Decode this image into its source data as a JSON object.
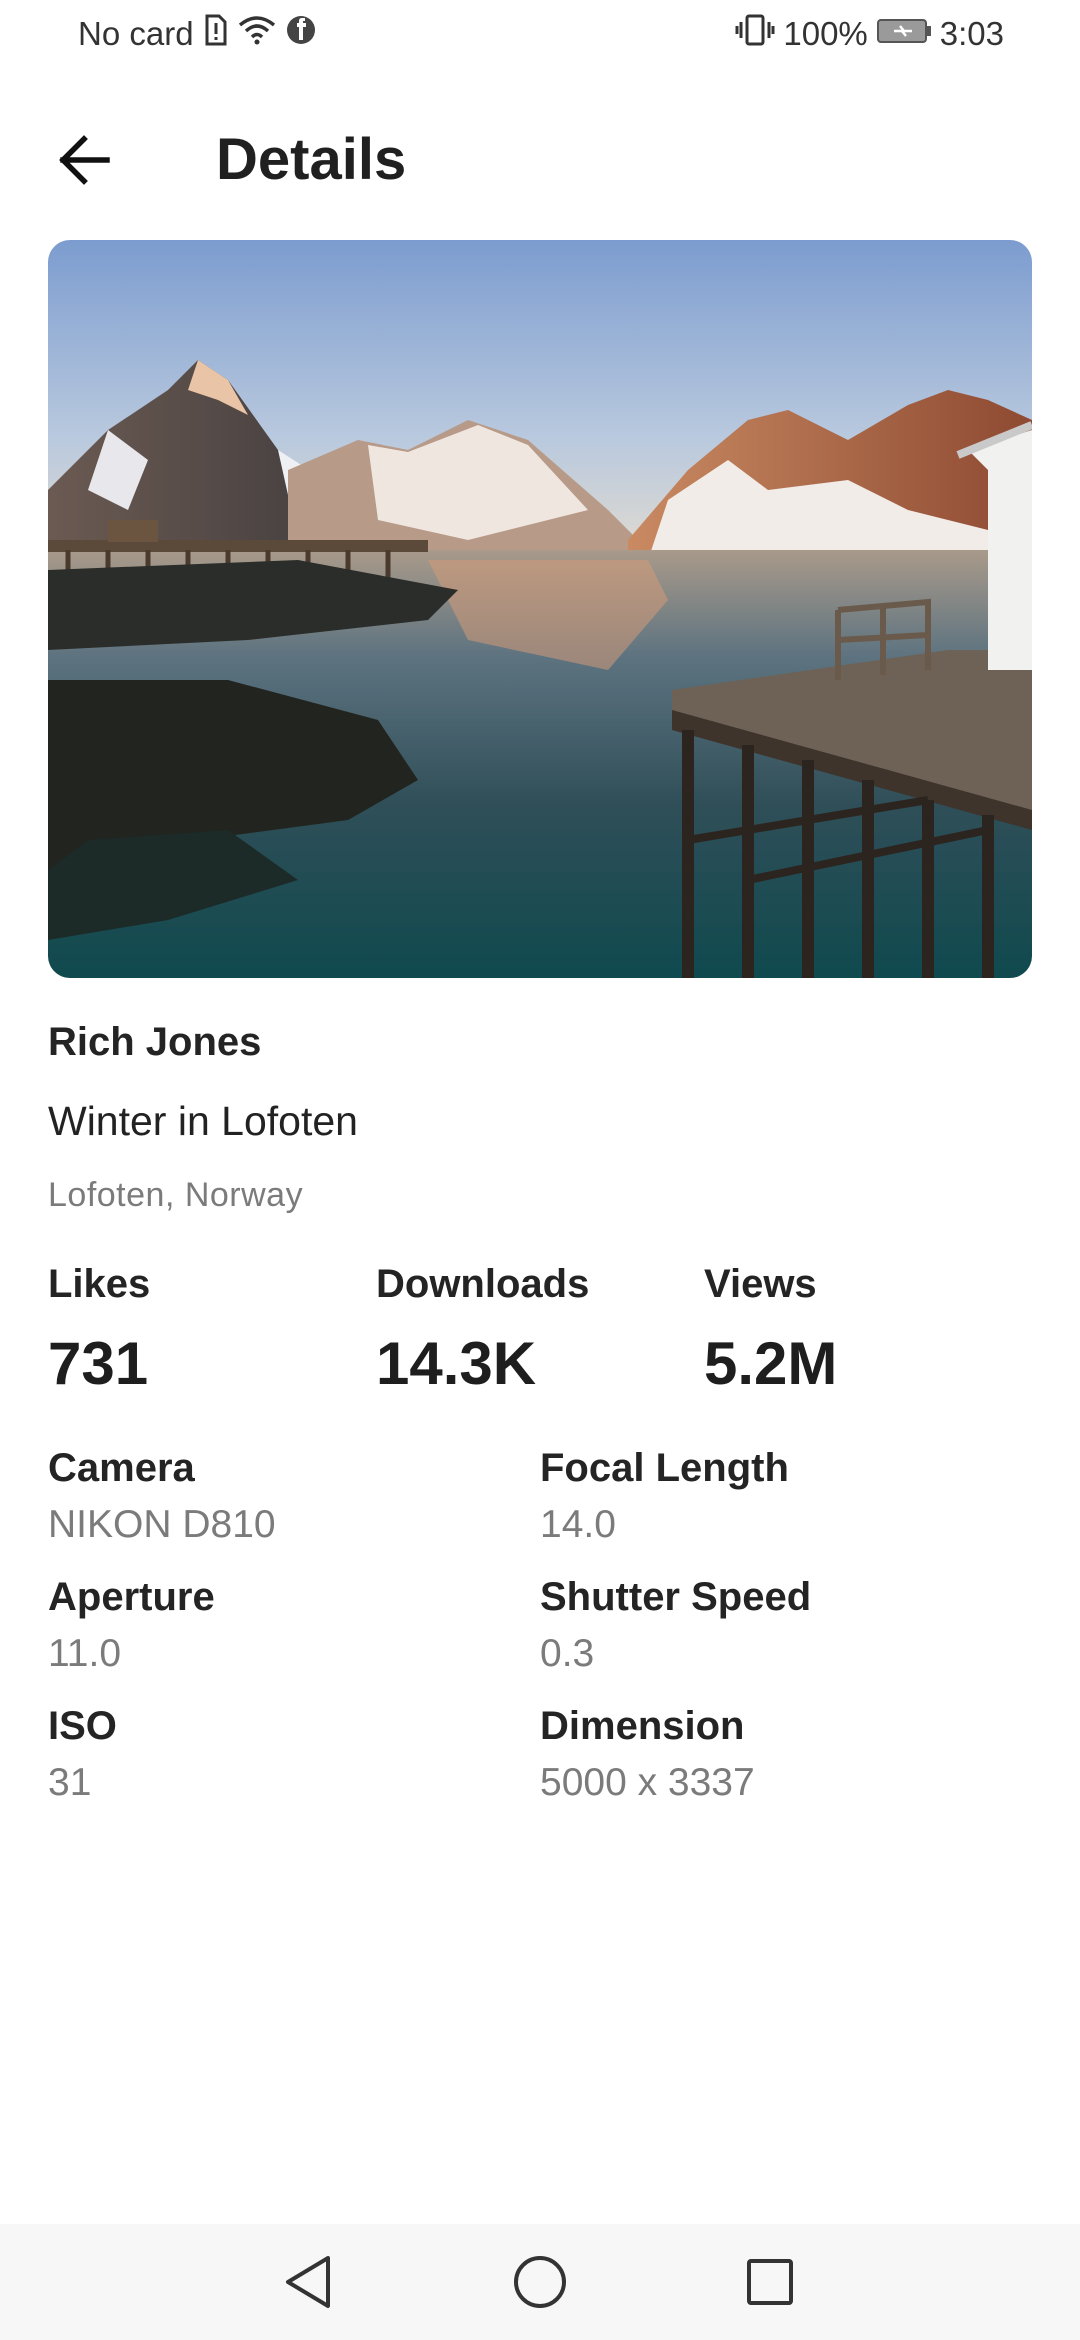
{
  "status_bar": {
    "carrier": "No card",
    "battery": "100%",
    "time": "3:03",
    "icons": [
      "sim-alert-icon",
      "wifi-icon",
      "facebook-icon",
      "vibrate-icon",
      "battery-charging-icon"
    ]
  },
  "header": {
    "title": "Details",
    "back_icon": "arrow-back-icon"
  },
  "photo": {
    "description_icon": "landscape-photo"
  },
  "details": {
    "author": "Rich Jones",
    "title": "Winter in Lofoten",
    "location": "Lofoten, Norway"
  },
  "stats": [
    {
      "label": "Likes",
      "value": "731"
    },
    {
      "label": "Downloads",
      "value": "14.3K"
    },
    {
      "label": "Views",
      "value": "5.2M"
    }
  ],
  "exif": [
    {
      "label": "Camera",
      "value": "NIKON D810"
    },
    {
      "label": "Focal Length",
      "value": "14.0"
    },
    {
      "label": "Aperture",
      "value": "11.0"
    },
    {
      "label": "Shutter Speed",
      "value": "0.3"
    },
    {
      "label": "ISO",
      "value": "31"
    },
    {
      "label": "Dimension",
      "value": "5000 x 3337"
    }
  ],
  "nav_bar": {
    "icons": [
      "nav-back-icon",
      "nav-home-icon",
      "nav-recents-icon"
    ]
  }
}
